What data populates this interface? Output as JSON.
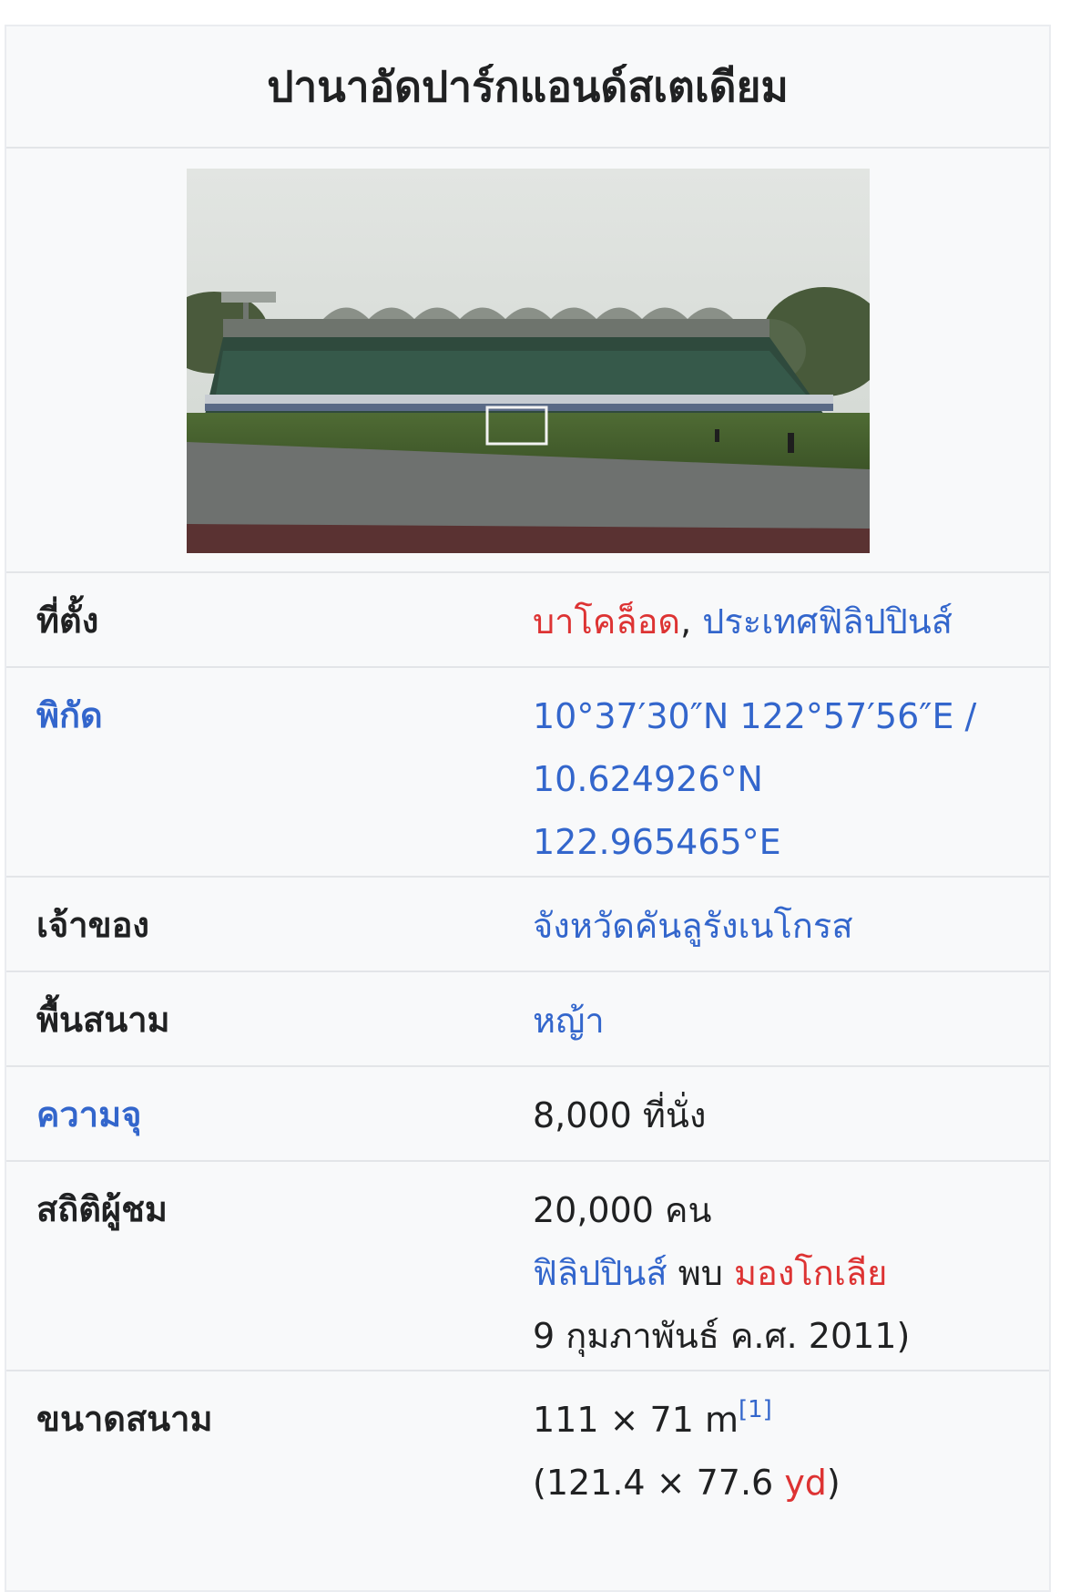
{
  "infobox": {
    "title": "ปานาอัดปาร์กแอนด์สเตเดียม",
    "image_alt": "stadium-photo",
    "rows": {
      "location": {
        "label": "ที่ตั้ง",
        "city": "บาโคล็อด",
        "separator": ",",
        "country": "ประเทศฟิลิปปินส์"
      },
      "coordinates": {
        "label": "พิกัด",
        "dms": "10°37′30″N 122°57′56″E /",
        "lat": "10.624926°N",
        "lon": "122.965465°E"
      },
      "owner": {
        "label": "เจ้าของ",
        "value": "จังหวัดคันลูรังเนโกรส"
      },
      "surface": {
        "label": "พื้นสนาม",
        "value": "หญ้า"
      },
      "capacity": {
        "label": "ความจุ",
        "value": "8,000 ที่นั่ง"
      },
      "attendance": {
        "label": "สถิติผู้ชม",
        "count": "20,000 คน",
        "team1": "ฟิลิปปินส์",
        "vs": "พบ",
        "team2": "มองโกเลีย",
        "date": "9 กุมภาพันธ์ ค.ศ. 2011)"
      },
      "field_size": {
        "label": "ขนาดสนาม",
        "metric": "111 × 71 m",
        "ref": "[1]",
        "imperial_prefix": "(121.4 × 77.6 ",
        "imperial_unit": "yd",
        "imperial_suffix": ")"
      }
    }
  },
  "colors": {
    "link": "#3366cc",
    "redlink": "#dd3333",
    "text": "#202122",
    "box_bg": "#f8f9fa",
    "border": "#e3e5e8"
  }
}
